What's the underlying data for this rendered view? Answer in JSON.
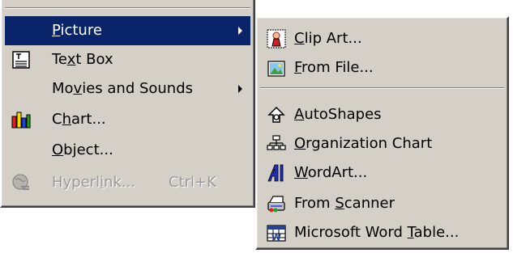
{
  "main_menu": {
    "items": [
      {
        "pre": "",
        "u": "P",
        "post": "icture",
        "shortcut": ""
      },
      {
        "pre": "Te",
        "u": "x",
        "post": "t Box",
        "shortcut": ""
      },
      {
        "pre": "Mo",
        "u": "v",
        "post": "ies and Sounds",
        "shortcut": ""
      },
      {
        "pre": "C",
        "u": "h",
        "post": "art...",
        "shortcut": ""
      },
      {
        "pre": "",
        "u": "O",
        "post": "bject...",
        "shortcut": ""
      },
      {
        "pre": "Hyperl",
        "u": "i",
        "post": "nk...",
        "shortcut": "Ctrl+K"
      }
    ]
  },
  "sub_menu": {
    "items": [
      {
        "pre": "",
        "u": "C",
        "post": "lip Art..."
      },
      {
        "pre": "",
        "u": "F",
        "post": "rom File..."
      },
      {
        "pre": "",
        "u": "A",
        "post": "utoShapes"
      },
      {
        "pre": "",
        "u": "O",
        "post": "rganization Chart"
      },
      {
        "pre": "",
        "u": "W",
        "post": "ordArt..."
      },
      {
        "pre": "From ",
        "u": "S",
        "post": "canner"
      },
      {
        "pre": "Microsoft Word ",
        "u": "T",
        "post": "able..."
      }
    ]
  },
  "colors": {
    "menu_face": "#d4d0c8",
    "highlight": "#0a246a",
    "disabled_text": "#9a9a9a"
  },
  "icons": {
    "text_box": "text-box-icon",
    "chart": "chart-icon",
    "hyperlink": "hyperlink-globe-icon",
    "clip_art": "clip-art-icon",
    "from_file": "picture-file-icon",
    "autoshapes": "autoshapes-icon",
    "org_chart": "org-chart-icon",
    "wordart": "wordart-icon",
    "scanner": "scanner-icon",
    "word_table": "word-table-icon"
  }
}
